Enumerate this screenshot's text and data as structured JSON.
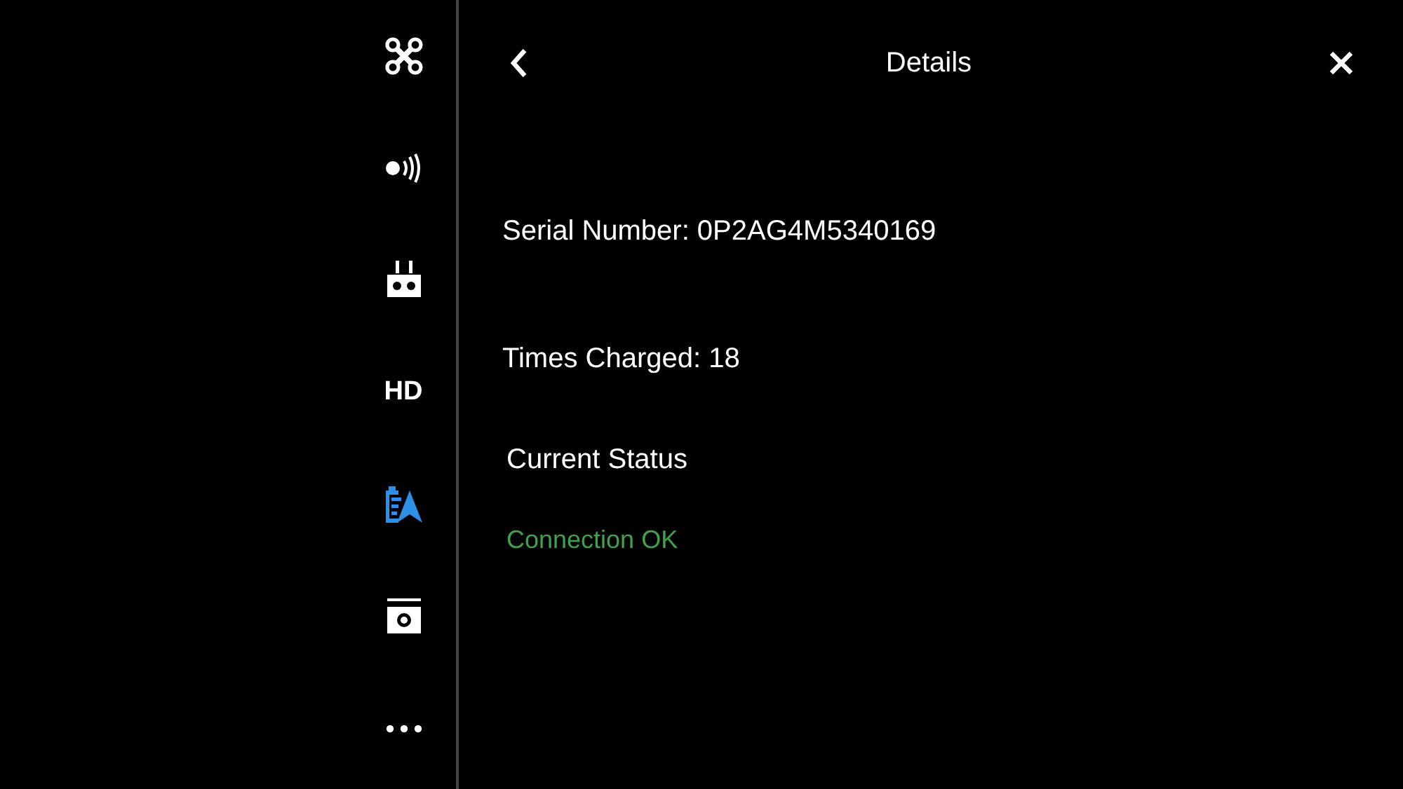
{
  "sidebar": {
    "items": [
      {
        "kind": "drone",
        "selected": false
      },
      {
        "kind": "signal",
        "selected": false
      },
      {
        "kind": "remote",
        "selected": false
      },
      {
        "kind": "text",
        "label": "HD",
        "selected": false
      },
      {
        "kind": "battery",
        "selected": true
      },
      {
        "kind": "camera",
        "selected": false
      },
      {
        "kind": "more",
        "selected": false
      }
    ]
  },
  "header": {
    "title": "Details"
  },
  "details": {
    "serial": "Serial Number: 0P2AG4M5340169",
    "times_charged": "Times Charged: 18",
    "status_heading": "Current Status",
    "status": "Connection OK"
  }
}
